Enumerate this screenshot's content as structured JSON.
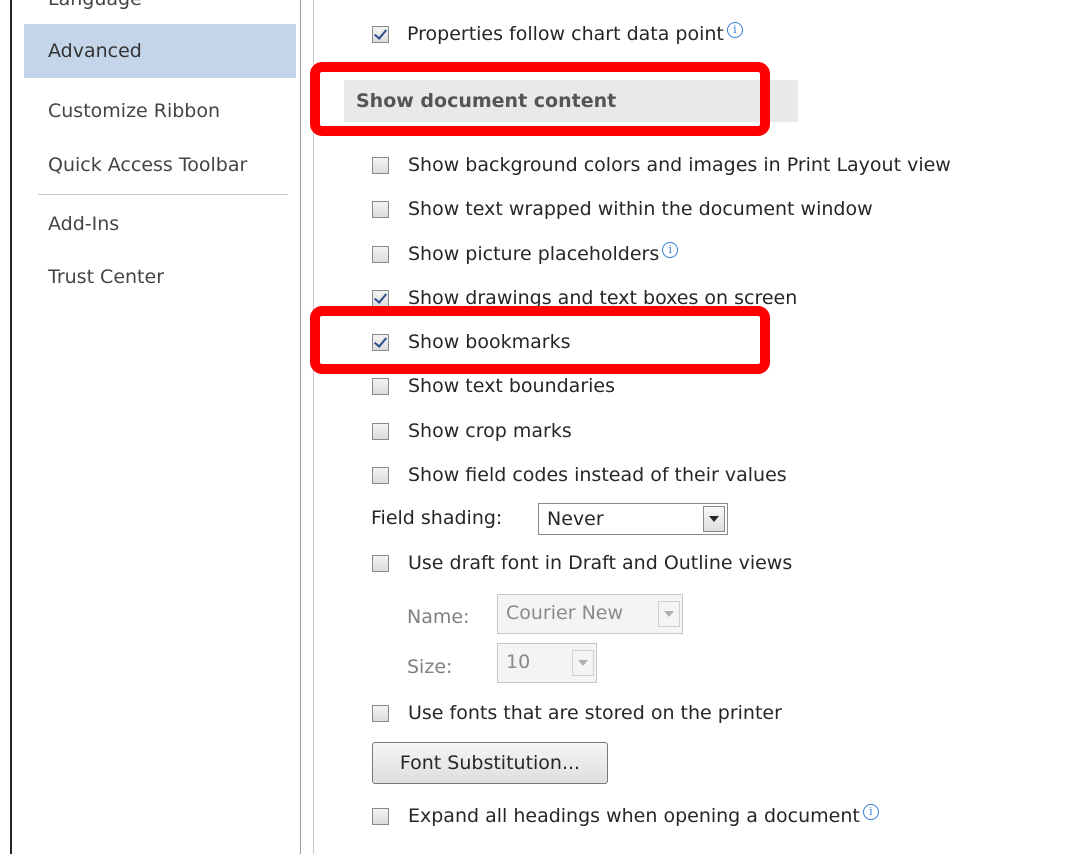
{
  "sidebar": {
    "cut_top_label": "Language",
    "items": [
      {
        "label": "Advanced",
        "selected": true
      },
      {
        "label": "Customize Ribbon",
        "selected": false
      },
      {
        "label": "Quick Access Toolbar",
        "selected": false
      },
      {
        "label": "Add-Ins",
        "selected": false
      },
      {
        "label": "Trust Center",
        "selected": false
      }
    ]
  },
  "content": {
    "properties_follow": {
      "label": "Properties follow chart data point",
      "checked": true
    },
    "section_title": "Show document content",
    "options": [
      {
        "label": "Show background colors and images in Print Layout view",
        "checked": false
      },
      {
        "label": "Show text wrapped within the document window",
        "checked": false
      },
      {
        "label": "Show picture placeholders",
        "checked": false
      },
      {
        "label": "Show drawings and text boxes on screen",
        "checked": true
      },
      {
        "label": "Show bookmarks",
        "checked": true
      },
      {
        "label": "Show text boundaries",
        "checked": false
      },
      {
        "label": "Show crop marks",
        "checked": false
      },
      {
        "label": "Show field codes instead of their values",
        "checked": false
      }
    ],
    "field_shading": {
      "label": "Field shading:",
      "value": "Never"
    },
    "draft_font": {
      "label": "Use draft font in Draft and Outline views",
      "checked": false
    },
    "name_field": {
      "label": "Name:",
      "value": "Courier New"
    },
    "size_field": {
      "label": "Size:",
      "value": "10"
    },
    "printer_fonts": {
      "label": "Use fonts that are stored on the printer",
      "checked": false
    },
    "font_substitution_button": "Font Substitution...",
    "expand_headings": {
      "label": "Expand all headings when opening a document",
      "checked": false
    }
  },
  "colors": {
    "highlight": "#ff0000",
    "sidebar_selected": "#c5d5e9",
    "section_header_bg": "#e9e9e9"
  }
}
